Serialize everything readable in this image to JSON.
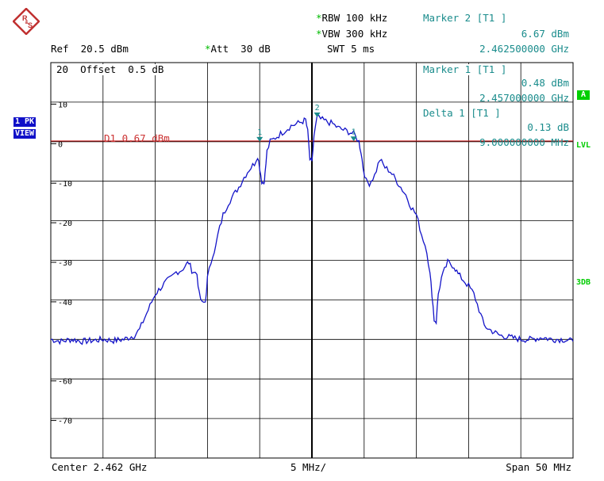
{
  "logo": {
    "name": "rohde-schwarz-logo",
    "text": "R&S"
  },
  "header": {
    "rbw_label": "RBW",
    "rbw_value": "100 kHz",
    "vbw_label": "VBW",
    "vbw_value": "300 kHz",
    "swt_label": "SWT",
    "swt_value": "5 ms",
    "ref_label": "Ref",
    "ref_value": "20.5 dBm",
    "att_label": "Att",
    "att_value": "30 dB"
  },
  "marker2_panel": {
    "title": "Marker 2 [T1 ]",
    "level": "6.67 dBm",
    "freq": "2.462500000 GHz"
  },
  "marker1_panel": {
    "title": "Marker 1 [T1 ]",
    "level": "0.48 dBm",
    "freq": "2.457000000 GHz"
  },
  "delta_panel": {
    "title": "Delta 1 [T1 ]",
    "level": "0.13 dB",
    "freq": "9.000000000 MHz"
  },
  "offset_text": "20  Offset  0.5 dB",
  "display_line_label": "D1 0.67 dBm",
  "side_labels": {
    "trace_mode_1": "1 PK",
    "trace_mode_2": "VIEW",
    "a": "A",
    "lvl": "LVL",
    "three_db": "3DB"
  },
  "footer": {
    "center": "Center 2.462 GHz",
    "per_div": "5 MHz/",
    "span": "Span 50 MHz"
  },
  "chart_data": {
    "type": "line",
    "x_unit": "MHz offset from center (2.462 GHz)",
    "y_unit": "dBm",
    "xlim": [
      -25,
      25
    ],
    "ylim": [
      -79.5,
      20.5
    ],
    "y_tick_labels": [
      "10",
      "0",
      "-10",
      "-20",
      "-30",
      "-40",
      "-60",
      "-70"
    ],
    "y_tick_values": [
      10,
      0,
      -10,
      -20,
      -30,
      -40,
      -60,
      -70
    ],
    "grid": true,
    "display_line": {
      "label": "D1 0.67 dBm",
      "value": 0.67,
      "color": "#cc2222"
    },
    "trace_color": "#1414c8",
    "series": [
      {
        "values": [
          [
            -25,
            -49.5
          ],
          [
            -24,
            -50
          ],
          [
            -23,
            -49.5
          ],
          [
            -22,
            -50
          ],
          [
            -21,
            -49.8
          ],
          [
            -20,
            -49.5
          ],
          [
            -19,
            -49.8
          ],
          [
            -18,
            -49.5
          ],
          [
            -17,
            -48.5
          ],
          [
            -16.5,
            -47
          ],
          [
            -16,
            -44
          ],
          [
            -15.5,
            -41
          ],
          [
            -15,
            -38
          ],
          [
            -14.5,
            -36.5
          ],
          [
            -14,
            -35
          ],
          [
            -13.5,
            -34
          ],
          [
            -13,
            -32.5
          ],
          [
            -12.5,
            -32
          ],
          [
            -12,
            -30.5
          ],
          [
            -11.8,
            -30
          ],
          [
            -11.5,
            -32
          ],
          [
            -11,
            -33
          ],
          [
            -10.8,
            -38
          ],
          [
            -10.5,
            -40.5
          ],
          [
            -10.2,
            -40
          ],
          [
            -10,
            -34
          ],
          [
            -9.5,
            -28
          ],
          [
            -9.2,
            -26
          ],
          [
            -9,
            -23
          ],
          [
            -8.5,
            -18
          ],
          [
            -8,
            -15
          ],
          [
            -7.5,
            -13
          ],
          [
            -7,
            -11
          ],
          [
            -6.5,
            -8.5
          ],
          [
            -6,
            -6.5
          ],
          [
            -5.5,
            -5
          ],
          [
            -5.2,
            -3
          ],
          [
            -5,
            -6
          ],
          [
            -4.8,
            -9.5
          ],
          [
            -4.6,
            -10
          ],
          [
            -4.5,
            -8
          ],
          [
            -4.3,
            -2
          ],
          [
            -4,
            0.5
          ],
          [
            -3.5,
            1.5
          ],
          [
            -3,
            2.5
          ],
          [
            -2.5,
            3.5
          ],
          [
            -2,
            4.5
          ],
          [
            -1.5,
            5
          ],
          [
            -1,
            5.5
          ],
          [
            -0.6,
            6
          ],
          [
            -0.4,
            3
          ],
          [
            -0.2,
            -4
          ],
          [
            0,
            -5
          ],
          [
            0.2,
            2
          ],
          [
            0.5,
            6.67
          ],
          [
            1,
            6
          ],
          [
            1.5,
            5.5
          ],
          [
            2,
            5
          ],
          [
            2.5,
            4
          ],
          [
            3,
            3.5
          ],
          [
            3.5,
            3
          ],
          [
            4,
            2.5
          ],
          [
            4.5,
            0.5
          ],
          [
            4.7,
            -2
          ],
          [
            4.9,
            -6
          ],
          [
            5.2,
            -9.5
          ],
          [
            5.5,
            -10
          ],
          [
            6,
            -8
          ],
          [
            6.5,
            -4
          ],
          [
            7,
            -6
          ],
          [
            7.5,
            -7
          ],
          [
            8,
            -9
          ],
          [
            8.5,
            -11
          ],
          [
            9,
            -13
          ],
          [
            9.5,
            -16
          ],
          [
            10,
            -18
          ],
          [
            10.5,
            -23
          ],
          [
            11,
            -27
          ],
          [
            11.3,
            -33
          ],
          [
            11.5,
            -38
          ],
          [
            11.7,
            -44.5
          ],
          [
            11.9,
            -45
          ],
          [
            12.1,
            -38
          ],
          [
            12.4,
            -34
          ],
          [
            12.7,
            -32
          ],
          [
            13,
            -30
          ],
          [
            13.3,
            -30.5
          ],
          [
            13.6,
            -31
          ],
          [
            14,
            -33
          ],
          [
            14.5,
            -34.5
          ],
          [
            15,
            -36
          ],
          [
            15.5,
            -38
          ],
          [
            16,
            -42
          ],
          [
            16.5,
            -46
          ],
          [
            17,
            -47
          ],
          [
            18,
            -48.5
          ],
          [
            19,
            -49
          ],
          [
            20,
            -49.5
          ],
          [
            21,
            -49.5
          ],
          [
            22,
            -49
          ],
          [
            23,
            -49.5
          ],
          [
            24,
            -49.5
          ],
          [
            25,
            -50
          ]
        ]
      }
    ],
    "markers": [
      {
        "label": "1",
        "x": -5,
        "y": 0.48
      },
      {
        "label": "2",
        "x": 0.5,
        "y": 6.67
      },
      {
        "label": "1",
        "x": 4,
        "y": 0.61
      }
    ],
    "center_line_x": 0
  }
}
